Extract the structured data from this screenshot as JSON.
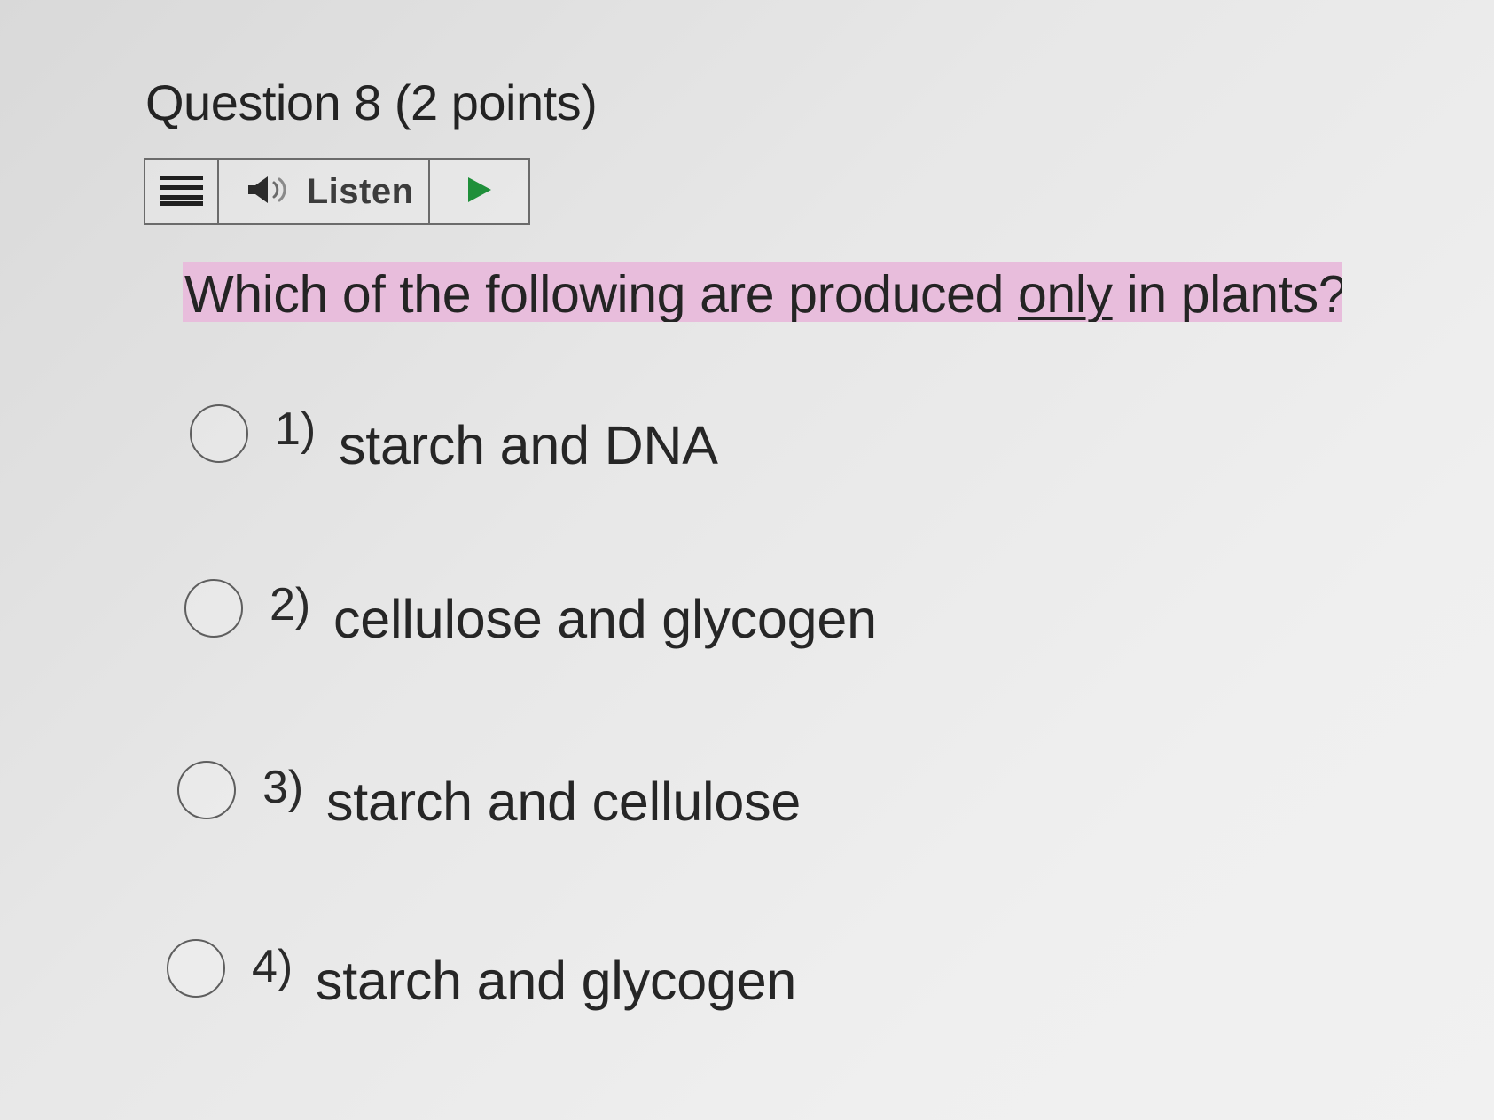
{
  "question": {
    "title": "Question 8 (2 points)"
  },
  "toolbar": {
    "menu_icon": "menu-icon",
    "speaker_icon": "speaker-icon",
    "listen_label": "Listen",
    "play_icon": "play-icon",
    "play_color": "#1f8f3a"
  },
  "prompt": {
    "before": "Which of the following are produced ",
    "emphasis": "only",
    "after": " in plants?",
    "highlight_color": "#e8bddc"
  },
  "options": [
    {
      "number": "1)",
      "label": "starch and DNA"
    },
    {
      "number": "2)",
      "label": "cellulose and glycogen"
    },
    {
      "number": "3)",
      "label": "starch and cellulose"
    },
    {
      "number": "4)",
      "label": "starch and glycogen"
    }
  ]
}
